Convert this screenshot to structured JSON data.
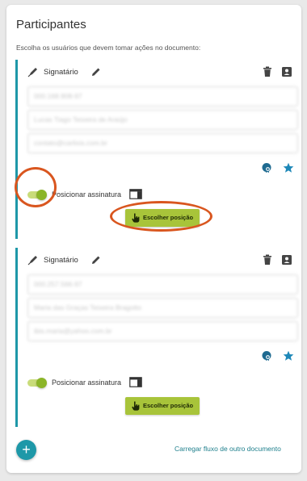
{
  "panel": {
    "title": "Participantes",
    "subtitle": "Escolha os usuários que devem tomar ações no documento:"
  },
  "participants": [
    {
      "role": "Signatário",
      "fields": [
        "000.168.908-97",
        "Lucas Tiago Teixeira de Araújo",
        "contato@carlixis.com.br"
      ],
      "toggle_label": "Posicionar assinatura",
      "toggle_on": true,
      "position_button": "Escolher posição"
    },
    {
      "role": "Signatário",
      "fields": [
        "000.257.566-97",
        "Maria das Graças Teixeira Bragotto",
        "ibis.maria@yahoo.com.br"
      ],
      "toggle_label": "Posicionar assinatura",
      "toggle_on": true,
      "position_button": "Escolher posição"
    }
  ],
  "footer": {
    "add_button": "+",
    "load_flow_link": "Carregar fluxo de outro documento"
  },
  "colors": {
    "accent": "#1e98a8",
    "button": "#a8c43a",
    "toggle": "#8bb528",
    "callout": "#d9561f"
  },
  "icons": [
    "signature-pen-icon",
    "edit-pencil-icon",
    "trash-icon",
    "contact-card-icon",
    "certificate-icon",
    "star-icon",
    "window-icon",
    "hand-pointer-icon",
    "plus-icon"
  ]
}
